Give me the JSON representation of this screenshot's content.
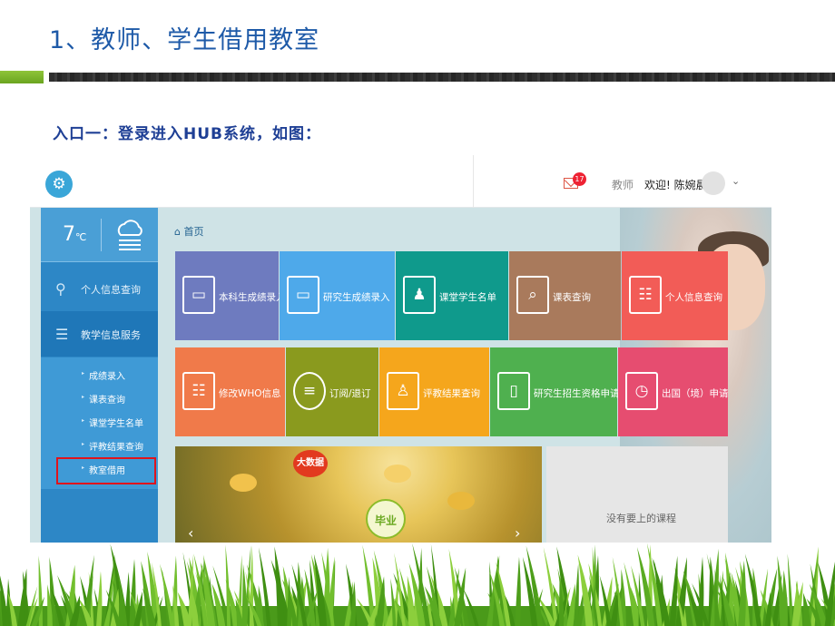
{
  "slide": {
    "title": "1、教师、学生借用教室",
    "entry_caption": "入口一：登录进入HUB系统，如图："
  },
  "topbar": {
    "mail_count": "17",
    "role": "教师",
    "welcome": "欢迎! 陈婉晨"
  },
  "sidebar": {
    "temperature": "7",
    "temperature_unit": "℃",
    "items": [
      {
        "label": "个人信息查询",
        "icon": "user-icon"
      },
      {
        "label": "教学信息服务",
        "icon": "document-icon"
      }
    ],
    "submenu": [
      "成绩录入",
      "课表查询",
      "课堂学生名单",
      "评教结果查询",
      "教室借用"
    ],
    "highlighted": "教室借用"
  },
  "main": {
    "breadcrumb": "首页",
    "tiles_row1": [
      {
        "label": "本科生成绩录入",
        "color": "#6e7bbf",
        "icon": "computer-icon"
      },
      {
        "label": "研究生成绩录入",
        "color": "#4ea9ea",
        "icon": "computer-icon"
      },
      {
        "label": "课堂学生名单",
        "color": "#0f9a8c",
        "icon": "classroom-icon"
      },
      {
        "label": "课表查询",
        "color": "#a97a5c",
        "icon": "search-document-icon"
      },
      {
        "label": "个人信息查询",
        "color": "#f25c57",
        "icon": "id-card-icon"
      }
    ],
    "tiles_row2": [
      {
        "label": "修改WHO信息",
        "color": "#f07a4a",
        "icon": "id-card-icon"
      },
      {
        "label": "订阅/退订",
        "color": "#8a9a1e",
        "icon": "chat-icon"
      },
      {
        "label": "评教结果查询",
        "color": "#f5a61c",
        "icon": "teacher-icon"
      },
      {
        "label": "研究生招生资格申请",
        "color": "#4fb04f",
        "icon": "tablet-icon"
      },
      {
        "label": "出国（境）申请",
        "color": "#e64d70",
        "icon": "clipboard-clock-icon"
      }
    ],
    "banner_badge": "大数据",
    "banner_round": "毕业",
    "course_panel_text": "没有要上的课程"
  }
}
